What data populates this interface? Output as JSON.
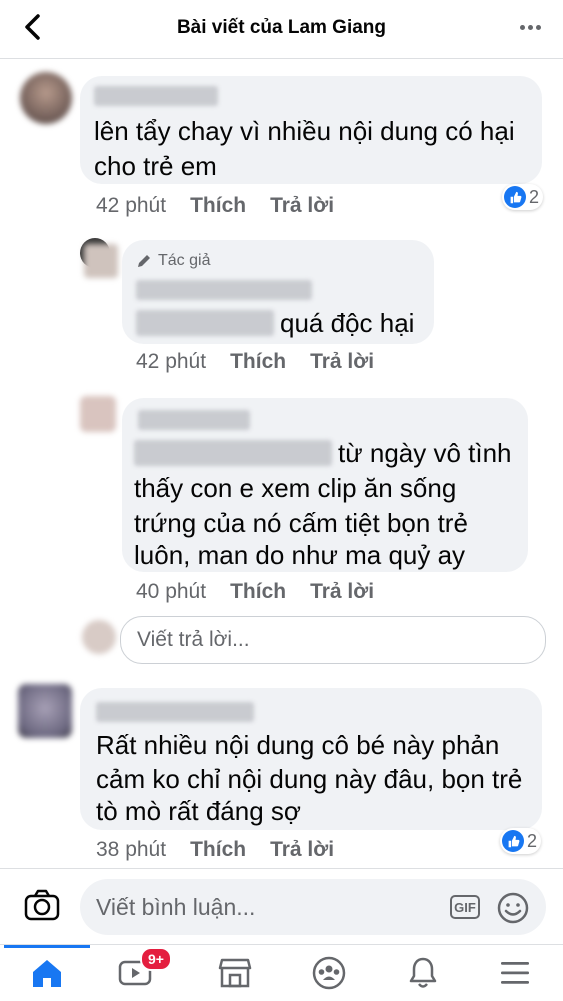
{
  "header": {
    "title": "Bài viết của Lam Giang"
  },
  "comments": [
    {
      "text_lines": [
        "lên tẩy chay vì nhiều nội dung  có hại",
        "cho trẻ em"
      ],
      "time": "42 phút",
      "like": "Thích",
      "reply": "Trả lời",
      "reactions": "2"
    },
    {
      "author_badge": "Tác giả",
      "text_lines": [
        "quá độc hại"
      ],
      "time": "42 phút",
      "like": "Thích",
      "reply": "Trả lời"
    },
    {
      "text_lines": [
        "từ ngày vô tình",
        "thấy con e xem clip ăn sống",
        "trứng của nó cấm tiệt bọn trẻ",
        "luôn, man do như ma quỷ ay"
      ],
      "time": "40 phút",
      "like": "Thích",
      "reply": "Trả lời"
    },
    {
      "text_lines": [
        "Rất nhiều nội dung cô bé này phản",
        "cảm ko chỉ nội dung này đâu, bọn trẻ",
        "tò mò rất đáng sợ"
      ],
      "time": "38 phút",
      "like": "Thích",
      "reply": "Trả lời",
      "reactions": "2"
    }
  ],
  "reply_box": {
    "placeholder": "Viết trả lời..."
  },
  "composer": {
    "placeholder": "Viết bình luận...",
    "gif_label": "GIF"
  },
  "tabbar": {
    "video_badge": "9+"
  },
  "colors": {
    "accent": "#1877f2",
    "bubble": "#f0f2f5",
    "meta": "#65676b",
    "badge": "#e41e3f"
  }
}
